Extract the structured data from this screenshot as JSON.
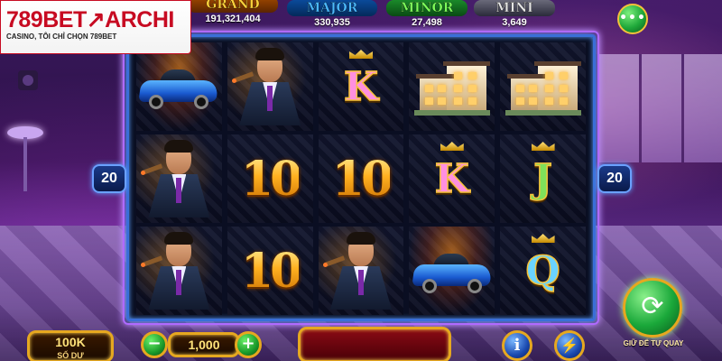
{
  "logo": {
    "brand_main": "789BET",
    "brand_arrow": "↗",
    "brand_suffix": "ARCHI",
    "slogan": "CASINO, TÔI CHỈ CHỌN 789BET"
  },
  "jackpots": {
    "grand": {
      "label": "GRAND",
      "value": "191,321,404"
    },
    "major": {
      "label": "MAJOR",
      "value": "330,935"
    },
    "minor": {
      "label": "MINOR",
      "value": "27,498"
    },
    "mini": {
      "label": "MINI",
      "value": "3,649"
    }
  },
  "menu_button": {
    "icon": "ellipsis-icon",
    "label": "•••"
  },
  "lines": {
    "left": "20",
    "right": "20"
  },
  "reels": [
    [
      "car",
      "man",
      "man"
    ],
    [
      "man",
      "10",
      "10"
    ],
    [
      "K",
      "10",
      "man"
    ],
    [
      "house",
      "K",
      "car"
    ],
    [
      "house",
      "J",
      "Q"
    ]
  ],
  "controls": {
    "balance": "100K",
    "balance_sub": "SỐ DƯ",
    "minus": "−",
    "bet": "1,000",
    "plus": "+",
    "info": "i",
    "turbo": "⚡",
    "auto_spin_icon": "⟳",
    "auto_spin_label": "GIỮ ĐỂ TỰ QUAY"
  },
  "colors": {
    "accent_gold": "#e6a820",
    "brand_red": "#c70b22",
    "frame_blue": "#3a6fd8"
  }
}
